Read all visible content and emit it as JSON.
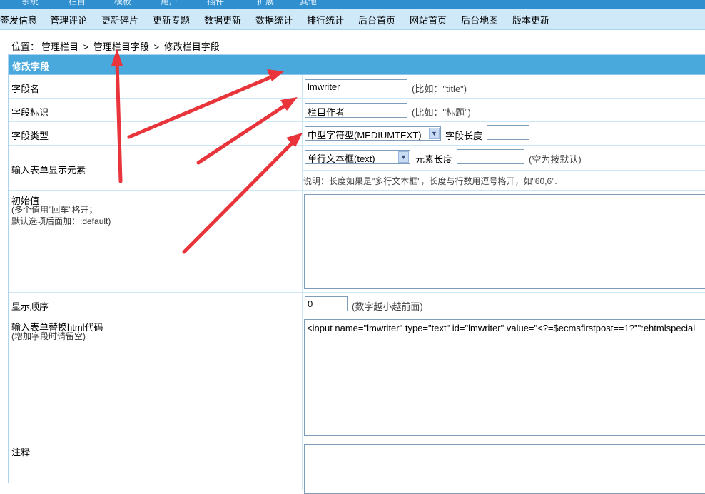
{
  "top_menu": [
    "系统",
    "栏目",
    "模板",
    "用户",
    "插件",
    "扩展",
    "其他"
  ],
  "nav": [
    "签发信息",
    "管理评论",
    "更新碎片",
    "更新专题",
    "数据更新",
    "数据统计",
    "排行统计",
    "后台首页",
    "网站首页",
    "后台地图",
    "版本更新"
  ],
  "breadcrumb": {
    "prefix": "位置：",
    "items": [
      "管理栏目",
      "管理栏目字段",
      "修改栏目字段"
    ],
    "sep": ">"
  },
  "form": {
    "title": "修改字段",
    "field_name": {
      "label": "字段名",
      "value": "lmwriter",
      "hint": "(比如：\"title\")"
    },
    "field_mark": {
      "label": "字段标识",
      "value": "栏目作者",
      "hint": "(比如：\"标题\")"
    },
    "field_type": {
      "label": "字段类型",
      "selected": "中型字符型(MEDIUMTEXT)",
      "length_label": "字段长度",
      "length_value": ""
    },
    "input_element": {
      "label": "输入表单显示元素",
      "selected": "单行文本框(text)",
      "length_label": "元素长度",
      "length_value": "",
      "length_hint": "(空为按默认)",
      "note": "说明：长度如果是\"多行文本框\"，长度与行数用逗号格开，如\"60,6\"."
    },
    "initial_value": {
      "label": "初始值",
      "sub1": "(多个值用\"回车\"格开；",
      "sub2": "默认选项后面加：:default)",
      "value": ""
    },
    "display_order": {
      "label": "显示顺序",
      "value": "0",
      "hint": "(数字越小越前面)"
    },
    "html_code": {
      "label": "输入表单替换html代码",
      "sub": "(增加字段时请留空)",
      "value": "<input name=\"lmwriter\" type=\"text\" id=\"lmwriter\" value=\"<?=$ecmsfirstpost==1?\"\":ehtmlspecial"
    },
    "comment": {
      "label": "注释",
      "value": ""
    }
  },
  "colors": {
    "nav_bg": "#cfe9f9",
    "title_bg": "#4aa9dc",
    "arrow": "#e8343a"
  }
}
